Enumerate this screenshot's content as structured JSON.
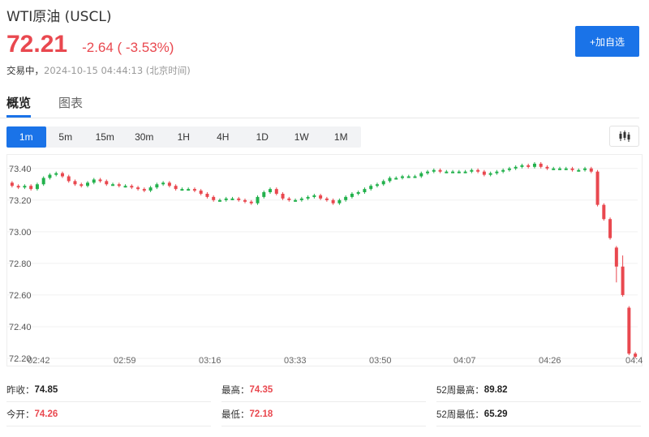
{
  "header": {
    "title": "WTI原油 (USCL)",
    "price": "72.21",
    "change": "-2.64 ( -3.53%)",
    "status": "交易中，",
    "timestamp": "2024-10-15 04:44:13 (北京时间)"
  },
  "watch_button": {
    "label": "+加自选"
  },
  "tabs": [
    {
      "label": "概览"
    },
    {
      "label": "图表"
    }
  ],
  "intervals": [
    "1m",
    "5m",
    "15m",
    "30m",
    "1H",
    "4H",
    "1D",
    "1W",
    "1M"
  ],
  "active_interval": "1m",
  "colors": {
    "up": "#22b14c",
    "down": "#e9484f",
    "accent": "#1a73e8"
  },
  "chart_data": {
    "type": "candlestick",
    "yticks": [
      "73.40",
      "73.20",
      "73.00",
      "72.80",
      "72.60",
      "72.40",
      "72.20"
    ],
    "xticks": [
      "02:42",
      "02:59",
      "03:16",
      "03:33",
      "03:50",
      "04:07",
      "04:26",
      "04:4"
    ],
    "ylim": [
      72.2,
      73.45
    ],
    "candles": [
      [
        73.31,
        73.29,
        73.32,
        73.28
      ],
      [
        73.29,
        73.28,
        73.3,
        73.27
      ],
      [
        73.28,
        73.29,
        73.3,
        73.27
      ],
      [
        73.29,
        73.27,
        73.3,
        73.26
      ],
      [
        73.27,
        73.3,
        73.31,
        73.26
      ],
      [
        73.3,
        73.34,
        73.35,
        73.29
      ],
      [
        73.34,
        73.36,
        73.37,
        73.33
      ],
      [
        73.36,
        73.37,
        73.38,
        73.35
      ],
      [
        73.37,
        73.35,
        73.38,
        73.34
      ],
      [
        73.35,
        73.32,
        73.36,
        73.31
      ],
      [
        73.32,
        73.3,
        73.33,
        73.29
      ],
      [
        73.3,
        73.29,
        73.31,
        73.28
      ],
      [
        73.29,
        73.31,
        73.32,
        73.28
      ],
      [
        73.31,
        73.33,
        73.34,
        73.3
      ],
      [
        73.33,
        73.32,
        73.34,
        73.31
      ],
      [
        73.32,
        73.3,
        73.33,
        73.29
      ],
      [
        73.3,
        73.3,
        73.31,
        73.29
      ],
      [
        73.3,
        73.29,
        73.31,
        73.28
      ],
      [
        73.29,
        73.29,
        73.3,
        73.28
      ],
      [
        73.29,
        73.28,
        73.3,
        73.27
      ],
      [
        73.28,
        73.27,
        73.29,
        73.26
      ],
      [
        73.27,
        73.26,
        73.28,
        73.25
      ],
      [
        73.26,
        73.28,
        73.29,
        73.25
      ],
      [
        73.28,
        73.3,
        73.31,
        73.27
      ],
      [
        73.3,
        73.31,
        73.32,
        73.29
      ],
      [
        73.31,
        73.29,
        73.32,
        73.28
      ],
      [
        73.29,
        73.27,
        73.3,
        73.26
      ],
      [
        73.27,
        73.27,
        73.28,
        73.26
      ],
      [
        73.27,
        73.27,
        73.28,
        73.26
      ],
      [
        73.27,
        73.26,
        73.28,
        73.25
      ],
      [
        73.26,
        73.24,
        73.27,
        73.23
      ],
      [
        73.24,
        73.22,
        73.25,
        73.21
      ],
      [
        73.22,
        73.2,
        73.23,
        73.19
      ],
      [
        73.2,
        73.2,
        73.21,
        73.19
      ],
      [
        73.2,
        73.21,
        73.22,
        73.19
      ],
      [
        73.21,
        73.21,
        73.22,
        73.2
      ],
      [
        73.21,
        73.2,
        73.22,
        73.19
      ],
      [
        73.2,
        73.19,
        73.21,
        73.18
      ],
      [
        73.19,
        73.18,
        73.2,
        73.17
      ],
      [
        73.18,
        73.22,
        73.23,
        73.17
      ],
      [
        73.22,
        73.25,
        73.26,
        73.21
      ],
      [
        73.25,
        73.27,
        73.28,
        73.24
      ],
      [
        73.27,
        73.24,
        73.28,
        73.23
      ],
      [
        73.24,
        73.21,
        73.25,
        73.2
      ],
      [
        73.21,
        73.2,
        73.22,
        73.19
      ],
      [
        73.2,
        73.2,
        73.21,
        73.19
      ],
      [
        73.2,
        73.21,
        73.22,
        73.19
      ],
      [
        73.21,
        73.22,
        73.23,
        73.2
      ],
      [
        73.22,
        73.23,
        73.24,
        73.21
      ],
      [
        73.23,
        73.21,
        73.24,
        73.2
      ],
      [
        73.21,
        73.2,
        73.22,
        73.19
      ],
      [
        73.2,
        73.18,
        73.21,
        73.17
      ],
      [
        73.18,
        73.2,
        73.21,
        73.17
      ],
      [
        73.2,
        73.22,
        73.23,
        73.19
      ],
      [
        73.22,
        73.24,
        73.25,
        73.21
      ],
      [
        73.24,
        73.25,
        73.26,
        73.23
      ],
      [
        73.25,
        73.27,
        73.28,
        73.24
      ],
      [
        73.27,
        73.29,
        73.3,
        73.26
      ],
      [
        73.29,
        73.3,
        73.31,
        73.28
      ],
      [
        73.3,
        73.32,
        73.33,
        73.29
      ],
      [
        73.32,
        73.34,
        73.35,
        73.31
      ],
      [
        73.34,
        73.34,
        73.35,
        73.33
      ],
      [
        73.34,
        73.35,
        73.36,
        73.33
      ],
      [
        73.35,
        73.35,
        73.36,
        73.34
      ],
      [
        73.35,
        73.35,
        73.36,
        73.34
      ],
      [
        73.35,
        73.37,
        73.38,
        73.34
      ],
      [
        73.37,
        73.38,
        73.39,
        73.36
      ],
      [
        73.38,
        73.39,
        73.4,
        73.37
      ],
      [
        73.39,
        73.38,
        73.4,
        73.37
      ],
      [
        73.38,
        73.38,
        73.39,
        73.37
      ],
      [
        73.38,
        73.38,
        73.39,
        73.37
      ],
      [
        73.38,
        73.38,
        73.39,
        73.37
      ],
      [
        73.38,
        73.38,
        73.39,
        73.37
      ],
      [
        73.38,
        73.39,
        73.4,
        73.37
      ],
      [
        73.39,
        73.38,
        73.4,
        73.37
      ],
      [
        73.38,
        73.36,
        73.39,
        73.35
      ],
      [
        73.36,
        73.37,
        73.38,
        73.35
      ],
      [
        73.37,
        73.38,
        73.39,
        73.36
      ],
      [
        73.38,
        73.39,
        73.4,
        73.37
      ],
      [
        73.39,
        73.4,
        73.41,
        73.38
      ],
      [
        73.4,
        73.41,
        73.42,
        73.39
      ],
      [
        73.41,
        73.42,
        73.43,
        73.4
      ],
      [
        73.42,
        73.41,
        73.43,
        73.4
      ],
      [
        73.41,
        73.43,
        73.44,
        73.4
      ],
      [
        73.43,
        73.41,
        73.44,
        73.4
      ],
      [
        73.41,
        73.4,
        73.42,
        73.39
      ],
      [
        73.4,
        73.4,
        73.41,
        73.39
      ],
      [
        73.4,
        73.4,
        73.41,
        73.39
      ],
      [
        73.4,
        73.4,
        73.41,
        73.39
      ],
      [
        73.4,
        73.39,
        73.41,
        73.38
      ],
      [
        73.39,
        73.39,
        73.4,
        73.38
      ],
      [
        73.39,
        73.4,
        73.41,
        73.38
      ],
      [
        73.4,
        73.38,
        73.41,
        73.37
      ],
      [
        73.38,
        73.17,
        73.39,
        73.16
      ],
      [
        73.17,
        73.08,
        73.18,
        73.07
      ],
      [
        73.08,
        72.96,
        73.09,
        72.95
      ],
      [
        72.9,
        72.78,
        72.91,
        72.68
      ],
      [
        72.78,
        72.6,
        72.85,
        72.59
      ],
      [
        72.52,
        72.23,
        72.53,
        72.22
      ],
      [
        72.23,
        72.21,
        72.24,
        72.2
      ]
    ]
  },
  "stats": [
    {
      "label": "昨收：",
      "value": "74.85",
      "color": "black"
    },
    {
      "label": "最高：",
      "value": "74.35",
      "color": "red"
    },
    {
      "label": "52周最高：",
      "value": "89.82",
      "color": "black"
    },
    {
      "label": "今开：",
      "value": "74.26",
      "color": "red"
    },
    {
      "label": "最低：",
      "value": "72.18",
      "color": "red"
    },
    {
      "label": "52周最低：",
      "value": "65.29",
      "color": "black"
    }
  ]
}
